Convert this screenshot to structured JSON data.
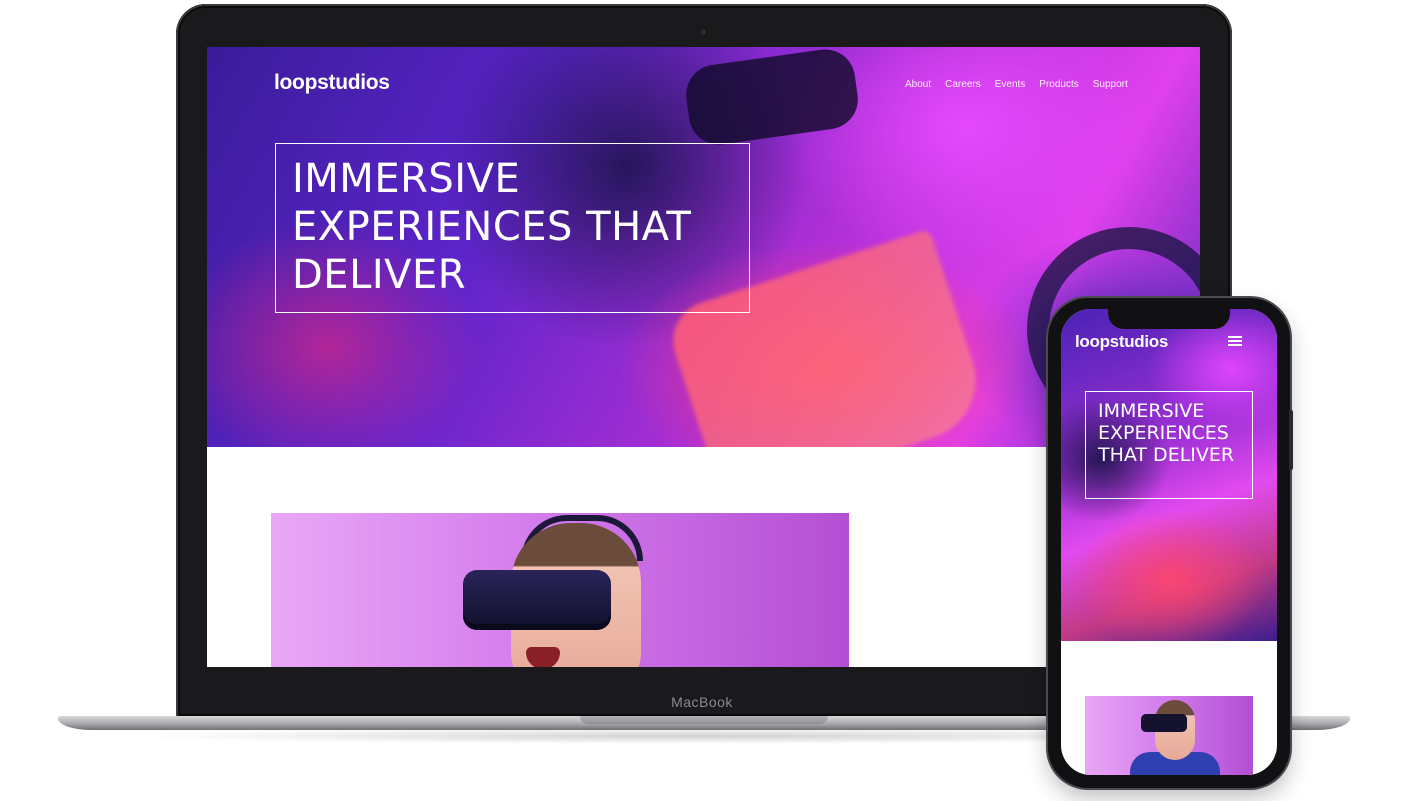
{
  "laptop": {
    "brand_label": "MacBook"
  },
  "desktop_site": {
    "logo": "loopstudios",
    "nav": [
      {
        "label": "About"
      },
      {
        "label": "Careers"
      },
      {
        "label": "Events"
      },
      {
        "label": "Products"
      },
      {
        "label": "Support"
      }
    ],
    "hero_title": "IMMERSIVE EXPERIENCES THAT DELIVER"
  },
  "mobile_site": {
    "logo": "loopstudios",
    "menu_icon": "hamburger-menu-icon",
    "hero_title": "IMMERSIVE EXPERIENCES THAT DELIVER"
  },
  "colors": {
    "hero_purple": "#5b24c9",
    "hero_magenta": "#e040ee",
    "hero_pink": "#ff3c6e",
    "feature_lavender": "#d47cec",
    "text_white": "#ffffff"
  }
}
